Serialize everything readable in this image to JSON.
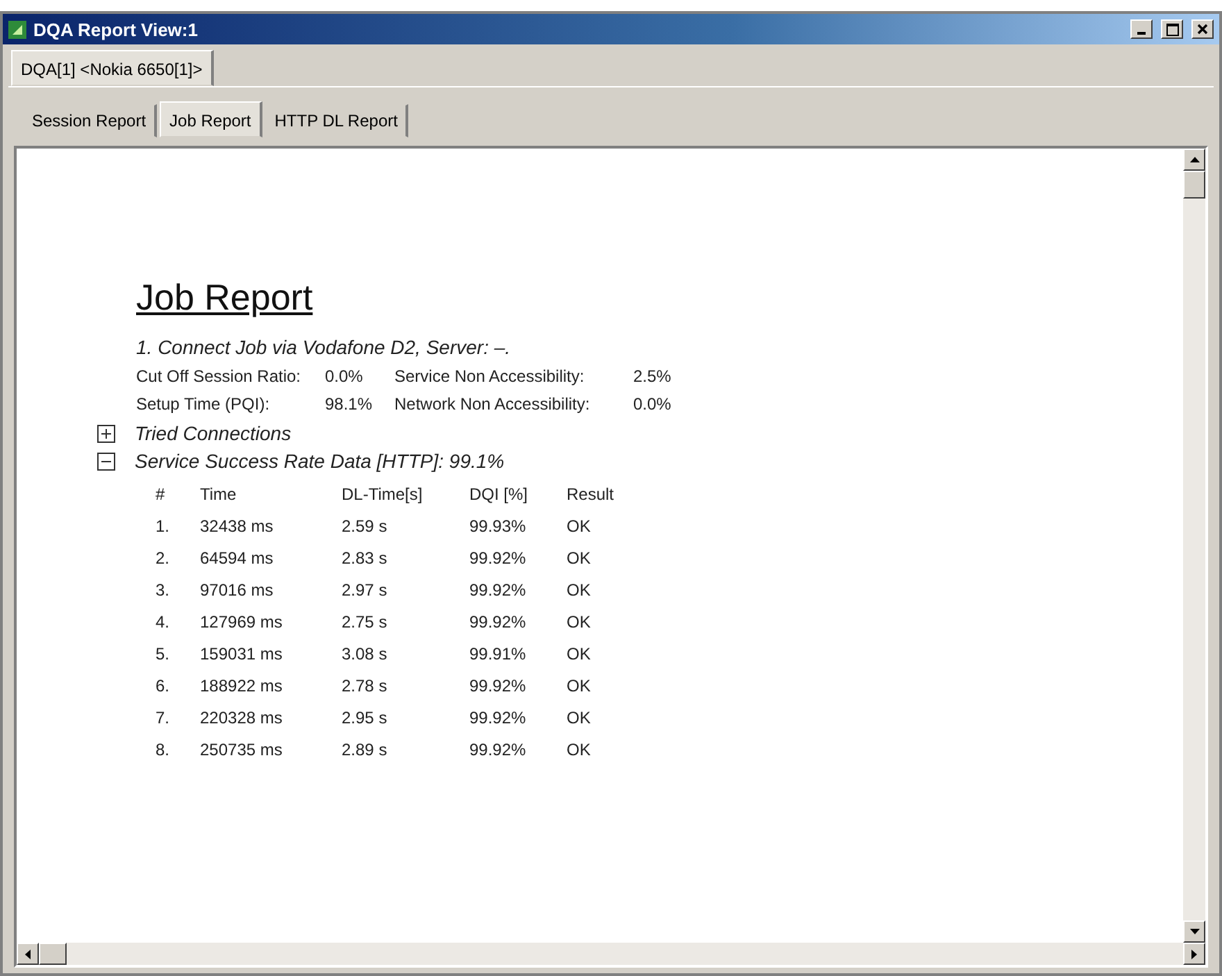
{
  "window": {
    "title": "DQA Report View:1"
  },
  "device_tabs": [
    {
      "label": "DQA[1] <Nokia 6650[1]>",
      "selected": true
    }
  ],
  "report_tabs": [
    {
      "label": "Session Report",
      "selected": false
    },
    {
      "label": "Job Report",
      "selected": true
    },
    {
      "label": "HTTP DL Report",
      "selected": false
    }
  ],
  "report": {
    "title": "Job Report",
    "job_heading": "1. Connect Job via Vodafone D2, Server: –.",
    "stats": [
      {
        "label": "Cut Off Session Ratio:",
        "value": "0.0%"
      },
      {
        "label": "Service Non Accessibility:",
        "value": "2.5%"
      },
      {
        "label": "Setup Time (PQI):",
        "value": "98.1%"
      },
      {
        "label": "Network Non Accessibility:",
        "value": "0.0%"
      }
    ],
    "sections": [
      {
        "label": "Tried Connections",
        "expanded": false
      },
      {
        "label": "Service Success Rate Data [HTTP]: 99.1%",
        "expanded": true,
        "table": {
          "columns": [
            "#",
            "Time",
            "DL-Time[s]",
            "DQI [%]",
            "Result"
          ],
          "rows": [
            [
              "1.",
              "32438 ms",
              "2.59 s",
              "99.93%",
              "OK"
            ],
            [
              "2.",
              "64594 ms",
              "2.83 s",
              "99.92%",
              "OK"
            ],
            [
              "3.",
              "97016 ms",
              "2.97 s",
              "99.92%",
              "OK"
            ],
            [
              "4.",
              "127969 ms",
              "2.75 s",
              "99.92%",
              "OK"
            ],
            [
              "5.",
              "159031 ms",
              "3.08 s",
              "99.91%",
              "OK"
            ],
            [
              "6.",
              "188922 ms",
              "2.78 s",
              "99.92%",
              "OK"
            ],
            [
              "7.",
              "220328 ms",
              "2.95 s",
              "99.92%",
              "OK"
            ],
            [
              "8.",
              "250735 ms",
              "2.89 s",
              "99.92%",
              "OK"
            ]
          ]
        }
      }
    ]
  }
}
